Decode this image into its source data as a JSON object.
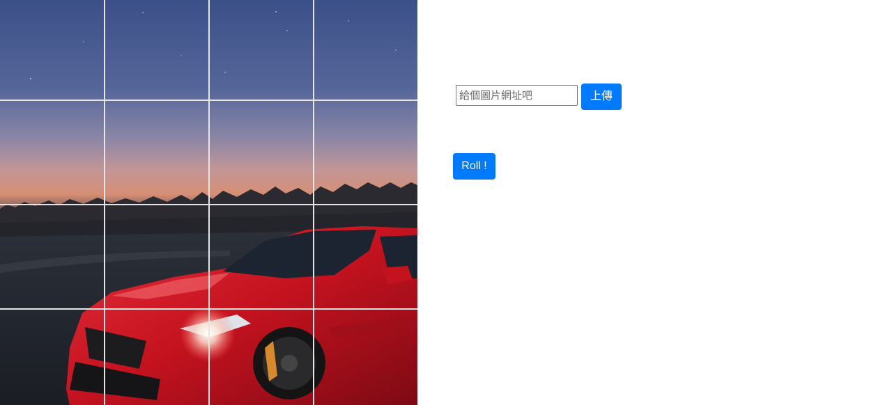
{
  "puzzle": {
    "rows": 4,
    "cols": 4,
    "image_description_icon": "car-photo-icon"
  },
  "controls": {
    "url_placeholder": "給個圖片網址吧",
    "url_value": "",
    "upload_label": "上傳",
    "roll_label": "Roll !"
  },
  "colors": {
    "accent": "#007bff",
    "grid_line": "#e6e6e6"
  }
}
